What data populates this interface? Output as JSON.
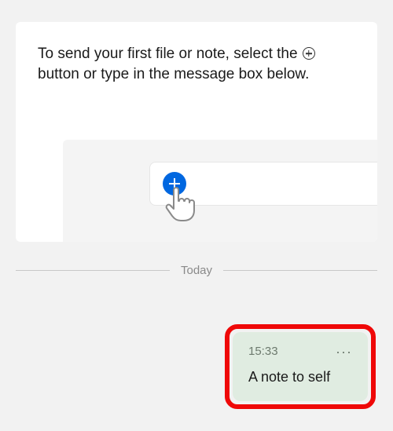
{
  "intro": {
    "text_before": "To send your first file or note, select the ",
    "text_after": " button or type in the message box below."
  },
  "icons": {
    "plus_circle": "plus-circle-icon",
    "pointer_hand": "pointer-hand-icon",
    "more": "more-icon"
  },
  "divider": {
    "label": "Today"
  },
  "note": {
    "time": "15:33",
    "more_glyph": "···",
    "body": "A note to self"
  },
  "colors": {
    "accent_blue": "#0067e0",
    "note_bg": "#e0ece1",
    "highlight_red": "#ef0808"
  }
}
